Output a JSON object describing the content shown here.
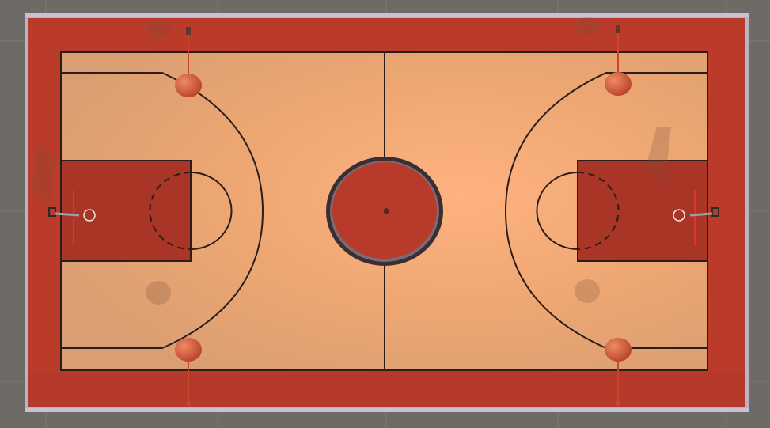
{
  "viewport": {
    "background": "#6e6b66",
    "grid_line_color": "#8a8782"
  },
  "court": {
    "surround_color": "#b83a2b",
    "floor_color_light": "#f2b07e",
    "floor_color_dark": "#e2a06c",
    "paint_color": "#a93527",
    "center_circle_color": "#b83a2b",
    "line_color": "#2b1e1a",
    "frame_color": "#b9b3c4"
  },
  "props": {
    "light_poles": 4,
    "hoops": 2,
    "pole_color": "#c8462e"
  }
}
